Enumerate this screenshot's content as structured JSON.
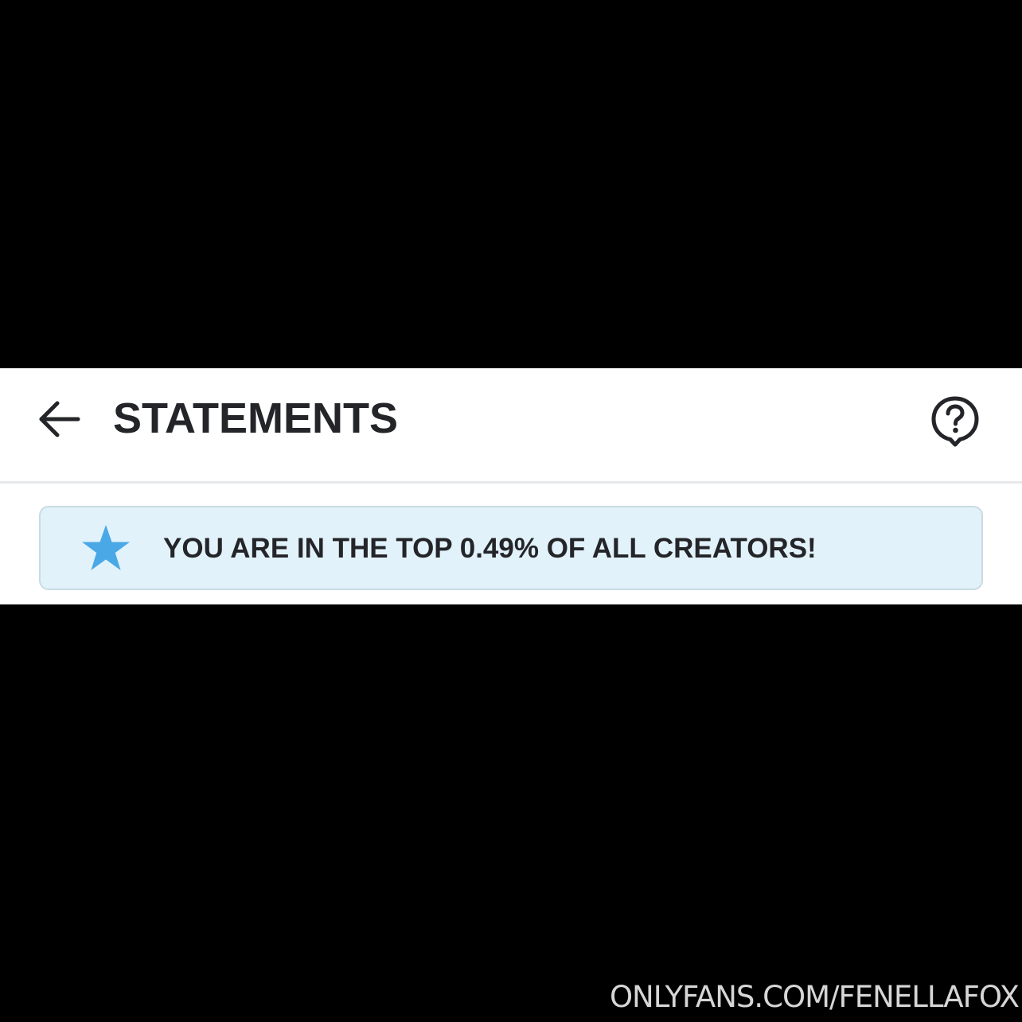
{
  "header": {
    "back_icon": "arrow-left-icon",
    "title": "STATEMENTS",
    "help_icon": "question-chat-bubble-icon"
  },
  "banner": {
    "icon": "star-icon",
    "text": "YOU ARE IN THE TOP 0.49% OF ALL CREATORS!"
  },
  "watermark": {
    "text": "ONLYFANS.COM/FENELLAFOX"
  },
  "colors": {
    "background": "#000000",
    "panel": "#ffffff",
    "title_text": "#242529",
    "banner_bg": "#e2f2fa",
    "banner_border": "#c9dbe4",
    "star": "#4aa8e6",
    "watermark": "#e9e9e9"
  }
}
